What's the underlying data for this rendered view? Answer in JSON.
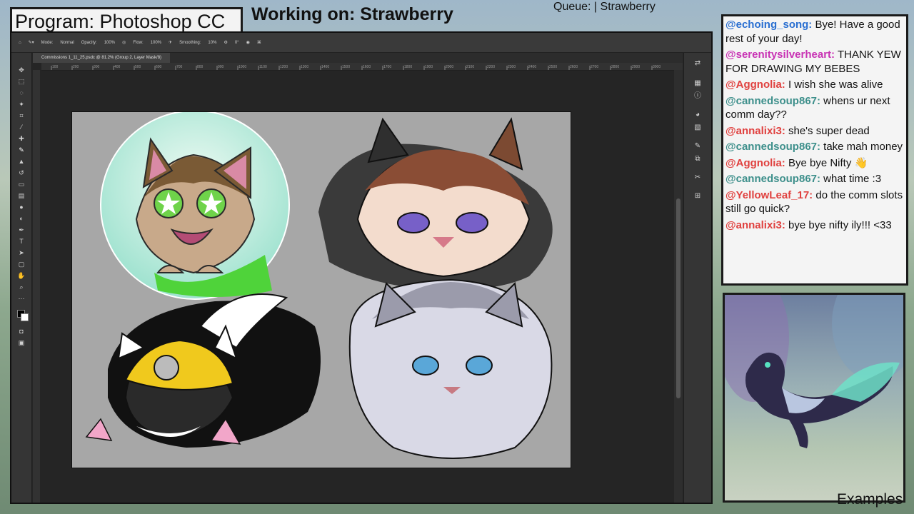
{
  "overlay": {
    "program": "Program: Photoshop CC",
    "working_on": "Working on: Strawberry",
    "queue": "Queue: | Strawberry",
    "examples": "Examples"
  },
  "photoshop": {
    "options_bar": {
      "mode_label": "Mode:",
      "mode_value": "Normal",
      "opacity_label": "Opacity:",
      "opacity_value": "100%",
      "flow_label": "Flow:",
      "flow_value": "100%",
      "smoothing_label": "Smoothing:",
      "smoothing_value": "10%",
      "angle_value": "0°"
    },
    "document_tab": "Commissions 1_11_25.psdc @ 81.2% (Group 2, Layer Mask/8)",
    "ruler_ticks": [
      "100",
      "200",
      "300",
      "400",
      "500",
      "600",
      "700",
      "800",
      "900",
      "1000",
      "1100",
      "1200",
      "1300",
      "1400",
      "1500",
      "1600",
      "1700",
      "1800",
      "1900",
      "2000",
      "2100",
      "2200",
      "2300",
      "2400",
      "2500",
      "2600",
      "2700",
      "2800",
      "2900",
      "3000"
    ]
  },
  "chat": {
    "messages": [
      {
        "user": "@echoing_song:",
        "text": " Bye! Have a good rest of your day!",
        "color": "#2a6fd1"
      },
      {
        "user": "@serenitysilverheart:",
        "text": " THANK YEW FOR DRAWING MY BEBES",
        "color": "#c832b4"
      },
      {
        "user": "@Aggnolia:",
        "text": " I wish she was alive",
        "color": "#e0413f"
      },
      {
        "user": "@cannedsoup867:",
        "text": " whens ur next comm day??",
        "color": "#3d8f8b"
      },
      {
        "user": "@annalixi3:",
        "text": " she's super dead",
        "color": "#e0413f"
      },
      {
        "user": "@cannedsoup867:",
        "text": " take mah money",
        "color": "#3d8f8b"
      },
      {
        "user": "@Aggnolia:",
        "text": " Bye bye Nifty 👋",
        "color": "#e0413f"
      },
      {
        "user": "@cannedsoup867:",
        "text": " what time :3",
        "color": "#3d8f8b"
      },
      {
        "user": "@YellowLeaf_17:",
        "text": " do the comm slots still go quick?",
        "color": "#e0413f"
      },
      {
        "user": "@annalixi3:",
        "text": " bye bye nifty ily!!! <33",
        "color": "#e0413f"
      }
    ]
  },
  "colors": {
    "chat_bg": "#f4f4f4",
    "canvas_bg": "#a7a7a7",
    "ps_dark": "#252525"
  },
  "icons": [
    "move-icon",
    "marquee-icon",
    "lasso-icon",
    "magic-wand-icon",
    "crop-icon",
    "eyedropper-icon",
    "brush-icon",
    "stamp-icon",
    "eraser-icon",
    "gradient-icon",
    "pen-icon",
    "type-icon",
    "hand-icon",
    "zoom-icon",
    "color-swatch-icon"
  ]
}
